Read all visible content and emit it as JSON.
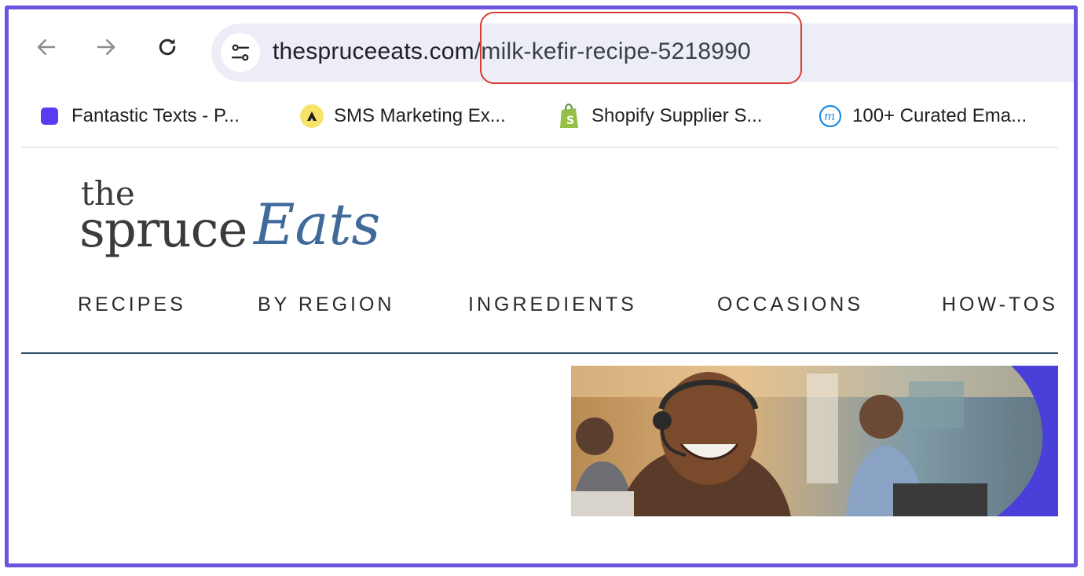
{
  "browser": {
    "url_domain": "thespruceeats.com",
    "url_path": "/milk-kefir-recipe-5218990",
    "bookmarks": [
      {
        "label": "Fantastic Texts - P...",
        "icon": "purple-square-icon"
      },
      {
        "label": "SMS Marketing Ex...",
        "icon": "attentive-logo-icon"
      },
      {
        "label": "Shopify Supplier S...",
        "icon": "shopify-bag-icon"
      },
      {
        "label": "100+ Curated Ema...",
        "icon": "m-circle-icon"
      }
    ]
  },
  "site": {
    "logo_the": "the",
    "logo_spruce": "spruce",
    "logo_eats": "Eats",
    "nav": [
      "RECIPES",
      "BY REGION",
      "INGREDIENTS",
      "OCCASIONS",
      "HOW-TOS"
    ]
  },
  "colors": {
    "frame": "#6b55e0",
    "highlight": "#d93b30",
    "omnibox": "#ecedf6",
    "logo_accent": "#3f6a9a"
  }
}
